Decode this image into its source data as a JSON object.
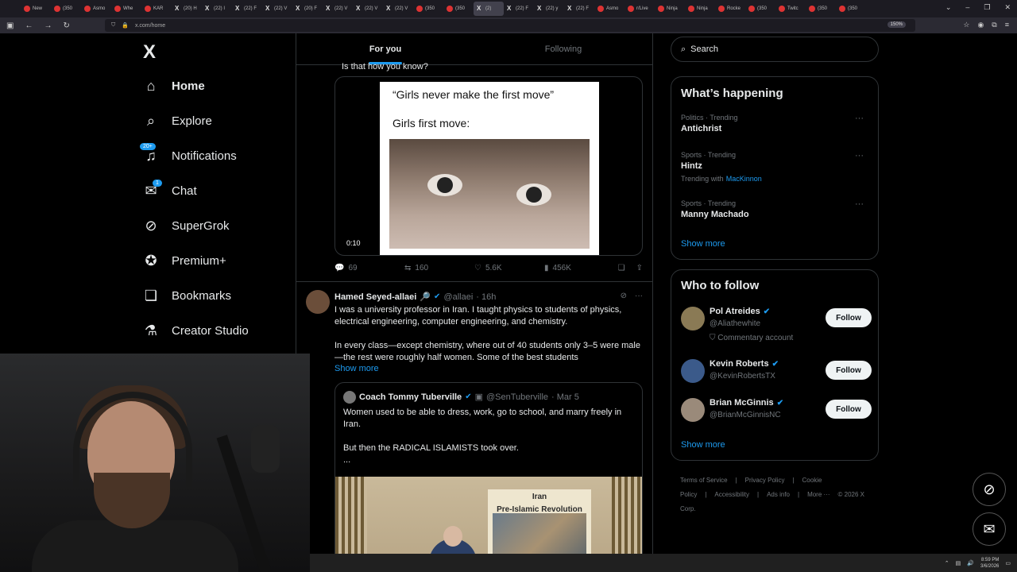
{
  "browser": {
    "tabs": [
      {
        "label": "New"
      },
      {
        "label": "(350"
      },
      {
        "label": "Asmo"
      },
      {
        "label": "Whe"
      },
      {
        "label": "KAR"
      },
      {
        "label": "(20) H"
      },
      {
        "label": "(22) I"
      },
      {
        "label": "(22) F"
      },
      {
        "label": "(22) V"
      },
      {
        "label": "(20) F"
      },
      {
        "label": "(22) V"
      },
      {
        "label": "(22) V"
      },
      {
        "label": "(22) V"
      },
      {
        "label": "(350"
      },
      {
        "label": "(350"
      },
      {
        "label": "(2)"
      },
      {
        "label": "(22) F"
      },
      {
        "label": "(22) y"
      },
      {
        "label": "(22) F"
      },
      {
        "label": "Asmo"
      },
      {
        "label": "r/Live"
      },
      {
        "label": "Ninja"
      },
      {
        "label": "Ninja"
      },
      {
        "label": "Rocke"
      },
      {
        "label": "(350"
      },
      {
        "label": "Twitc"
      },
      {
        "label": "(350"
      },
      {
        "label": "(350"
      }
    ],
    "url": "x.com/home",
    "zoom": "150%"
  },
  "sidebar": {
    "logo": "X",
    "items": [
      {
        "label": "Home",
        "icon": "home-icon",
        "glyph": "⌂",
        "active": true
      },
      {
        "label": "Explore",
        "icon": "search-icon",
        "glyph": "⌕"
      },
      {
        "label": "Notifications",
        "icon": "bell-icon",
        "glyph": "♫",
        "badge": "20+"
      },
      {
        "label": "Chat",
        "icon": "mail-icon",
        "glyph": "✉",
        "badge": "1"
      },
      {
        "label": "SuperGrok",
        "icon": "grok-icon",
        "glyph": "⊘"
      },
      {
        "label": "Premium+",
        "icon": "premium-icon",
        "glyph": "✪"
      },
      {
        "label": "Bookmarks",
        "icon": "bookmark-icon",
        "glyph": "❏"
      },
      {
        "label": "Creator Studio",
        "icon": "flask-icon",
        "glyph": "⚗"
      }
    ]
  },
  "feed": {
    "tabs": [
      {
        "label": "For you",
        "active": true
      },
      {
        "label": "Following"
      }
    ],
    "post1": {
      "text_tail": "Is that how you know?",
      "meme_line1": "“Girls never make the first move”",
      "meme_line2": "Girls first move:",
      "video_time": "0:10",
      "replies": "69",
      "reposts": "160",
      "likes": "5.6K",
      "views": "456K"
    },
    "post2": {
      "name": "Hamed Seyed-allaei",
      "name_emoji": "🔎",
      "handle": "@allaei",
      "time": "· 16h",
      "body1": "I was a university professor in Iran. I taught physics to students of physics, electrical engineering, computer engineering, and chemistry.",
      "body2": "In every class—except chemistry, where out of 40 students only 3–5 were male—the rest were roughly half women. Some of the best students",
      "show_more": "Show more",
      "quote": {
        "name": "Coach Tommy Tuberville",
        "handle": "@SenTuberville",
        "time": "· Mar 5",
        "body1": "Women used to be able to dress, work, go to school, and marry freely in Iran.",
        "body2": "But then the RADICAL ISLAMISTS took over.",
        "body3": "...",
        "poster_line1": "Iran",
        "poster_line2": "Pre-Islamic Revolution"
      }
    }
  },
  "right": {
    "search_placeholder": "Search",
    "happening_title": "What’s happening",
    "trends": [
      {
        "category": "Politics · Trending",
        "name": "Antichrist"
      },
      {
        "category": "Sports · Trending",
        "name": "Hintz",
        "with_label": "Trending with",
        "with": "MacKinnon"
      },
      {
        "category": "Sports · Trending",
        "name": "Manny Machado"
      }
    ],
    "happening_show_more": "Show more",
    "who_title": "Who to follow",
    "follows": [
      {
        "name": "Pol Atreides",
        "handle": "@Aliathewhite",
        "extra": "Commentary account",
        "avatar_color": "#8a7a55",
        "button": "Follow"
      },
      {
        "name": "Kevin Roberts",
        "handle": "@KevinRobertsTX",
        "avatar_color": "#3b5a8a",
        "button": "Follow"
      },
      {
        "name": "Brian McGinnis",
        "handle": "@BrianMcGinnisNC",
        "avatar_color": "#9a8a7a",
        "button": "Follow"
      }
    ],
    "who_show_more": "Show more",
    "footer": [
      "Terms of Service",
      "|",
      "Privacy Policy",
      "|",
      "Cookie Policy",
      "|",
      "Accessibility",
      "|",
      "Ads info",
      "|",
      "More ···",
      "© 2026 X Corp."
    ]
  },
  "taskbar": {
    "time": "8:59 PM",
    "date": "3/6/2026"
  }
}
